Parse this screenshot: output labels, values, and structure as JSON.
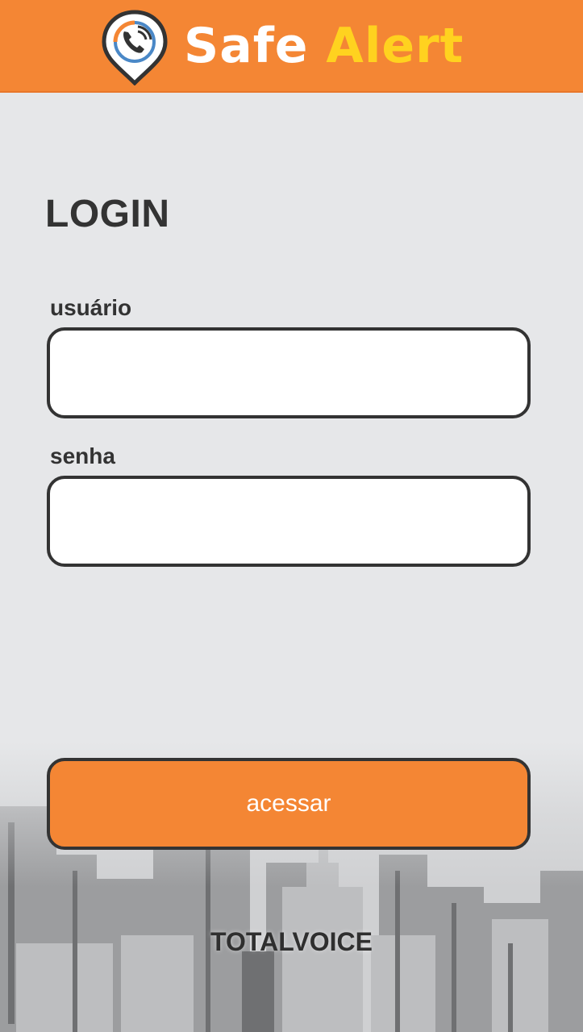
{
  "colors": {
    "brand_orange": "#f48634",
    "brand_yellow": "#ffd21f",
    "text_dark": "#333333",
    "background": "#e6e7e9"
  },
  "header": {
    "logo_icon": "phone-location-pin-icon",
    "brand_word1": "Safe",
    "brand_word2": "Alert"
  },
  "login": {
    "title": "LOGIN",
    "username_label": "usuário",
    "username_value": "",
    "password_label": "senha",
    "password_value": "",
    "submit_label": "acessar"
  },
  "footer": {
    "text": "TOTALVOICE"
  },
  "background_image": "city-skyline-grayscale"
}
